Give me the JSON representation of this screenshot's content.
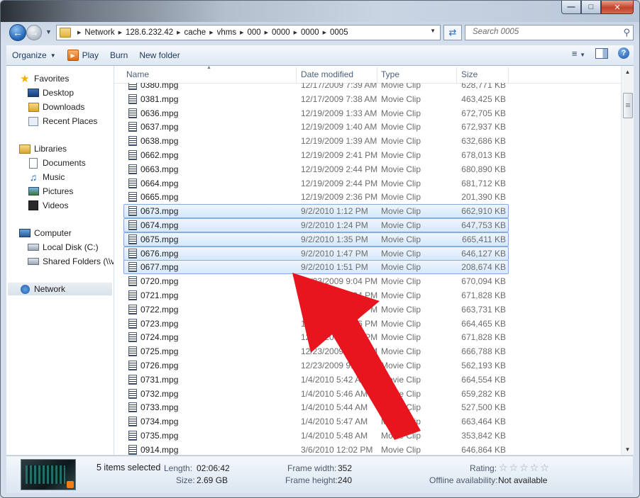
{
  "window": {
    "caption": {
      "minimize": "—",
      "maximize": "□",
      "close": "✕"
    }
  },
  "address": {
    "crumbs": [
      "Network",
      "128.6.232.42",
      "cache",
      "vhms",
      "000",
      "0000",
      "0000",
      "0005"
    ],
    "search_placeholder": "Search 0005"
  },
  "toolbar": {
    "organize": "Organize",
    "play": "Play",
    "burn": "Burn",
    "new_folder": "New folder"
  },
  "sidebar": {
    "favorites": "Favorites",
    "desktop": "Desktop",
    "downloads": "Downloads",
    "recent": "Recent Places",
    "libraries": "Libraries",
    "documents": "Documents",
    "music": "Music",
    "pictures": "Pictures",
    "videos": "Videos",
    "computer": "Computer",
    "local_disk": "Local Disk (C:)",
    "shared": "Shared Folders (\\\\vm",
    "network": "Network"
  },
  "columns": {
    "name": "Name",
    "date": "Date modified",
    "type": "Type",
    "size": "Size"
  },
  "files": [
    {
      "name": "0380.mpg",
      "date": "12/17/2009 7:39 AM",
      "type": "Movie Clip",
      "size": "628,771 KB",
      "selected": false
    },
    {
      "name": "0381.mpg",
      "date": "12/17/2009 7:38 AM",
      "type": "Movie Clip",
      "size": "463,425 KB",
      "selected": false
    },
    {
      "name": "0636.mpg",
      "date": "12/19/2009 1:33 AM",
      "type": "Movie Clip",
      "size": "672,705 KB",
      "selected": false
    },
    {
      "name": "0637.mpg",
      "date": "12/19/2009 1:40 AM",
      "type": "Movie Clip",
      "size": "672,937 KB",
      "selected": false
    },
    {
      "name": "0638.mpg",
      "date": "12/19/2009 1:39 AM",
      "type": "Movie Clip",
      "size": "632,686 KB",
      "selected": false
    },
    {
      "name": "0662.mpg",
      "date": "12/19/2009 2:41 PM",
      "type": "Movie Clip",
      "size": "678,013 KB",
      "selected": false
    },
    {
      "name": "0663.mpg",
      "date": "12/19/2009 2:44 PM",
      "type": "Movie Clip",
      "size": "680,890 KB",
      "selected": false
    },
    {
      "name": "0664.mpg",
      "date": "12/19/2009 2:44 PM",
      "type": "Movie Clip",
      "size": "681,712 KB",
      "selected": false
    },
    {
      "name": "0665.mpg",
      "date": "12/19/2009 2:36 PM",
      "type": "Movie Clip",
      "size": "201,390 KB",
      "selected": false
    },
    {
      "name": "0673.mpg",
      "date": "9/2/2010 1:12 PM",
      "type": "Movie Clip",
      "size": "662,910 KB",
      "selected": true
    },
    {
      "name": "0674.mpg",
      "date": "9/2/2010 1:24 PM",
      "type": "Movie Clip",
      "size": "647,753 KB",
      "selected": true
    },
    {
      "name": "0675.mpg",
      "date": "9/2/2010 1:35 PM",
      "type": "Movie Clip",
      "size": "665,411 KB",
      "selected": true
    },
    {
      "name": "0676.mpg",
      "date": "9/2/2010 1:47 PM",
      "type": "Movie Clip",
      "size": "646,127 KB",
      "selected": true
    },
    {
      "name": "0677.mpg",
      "date": "9/2/2010 1:51 PM",
      "type": "Movie Clip",
      "size": "208,674 KB",
      "selected": true
    },
    {
      "name": "0720.mpg",
      "date": "12/23/2009 9:04 PM",
      "type": "Movie Clip",
      "size": "670,094 KB",
      "selected": false
    },
    {
      "name": "0721.mpg",
      "date": "12/23/2009 9:04 PM",
      "type": "Movie Clip",
      "size": "671,828 KB",
      "selected": false
    },
    {
      "name": "0722.mpg",
      "date": "12/23/2009 9:04 PM",
      "type": "Movie Clip",
      "size": "663,731 KB",
      "selected": false
    },
    {
      "name": "0723.mpg",
      "date": "12/23/2009 9:06 PM",
      "type": "Movie Clip",
      "size": "664,465 KB",
      "selected": false
    },
    {
      "name": "0724.mpg",
      "date": "12/23/2009 9:09 PM",
      "type": "Movie Clip",
      "size": "671,828 KB",
      "selected": false
    },
    {
      "name": "0725.mpg",
      "date": "12/23/2009 9:10 PM",
      "type": "Movie Clip",
      "size": "666,788 KB",
      "selected": false
    },
    {
      "name": "0726.mpg",
      "date": "12/23/2009 9:14 PM",
      "type": "Movie Clip",
      "size": "562,193 KB",
      "selected": false
    },
    {
      "name": "0731.mpg",
      "date": "1/4/2010 5:42 AM",
      "type": "Movie Clip",
      "size": "664,554 KB",
      "selected": false
    },
    {
      "name": "0732.mpg",
      "date": "1/4/2010 5:46 AM",
      "type": "Movie Clip",
      "size": "659,282 KB",
      "selected": false
    },
    {
      "name": "0733.mpg",
      "date": "1/4/2010 5:44 AM",
      "type": "Movie Clip",
      "size": "527,500 KB",
      "selected": false
    },
    {
      "name": "0734.mpg",
      "date": "1/4/2010 5:47 AM",
      "type": "Movie Clip",
      "size": "663,464 KB",
      "selected": false
    },
    {
      "name": "0735.mpg",
      "date": "1/4/2010 5:48 AM",
      "type": "Movie Clip",
      "size": "353,842 KB",
      "selected": false
    },
    {
      "name": "0914.mpg",
      "date": "3/6/2010 12:02 PM",
      "type": "Movie Clip",
      "size": "646,864 KB",
      "selected": false
    }
  ],
  "details": {
    "count": "5 items selected",
    "length_label": "Length:",
    "length_value": "02:06:42",
    "size_label": "Size:",
    "size_value": "2.69 GB",
    "fw_label": "Frame width:",
    "fw_value": "352",
    "fh_label": "Frame height:",
    "fh_value": "240",
    "rating_label": "Rating:",
    "rating_stars": "☆☆☆☆☆",
    "offline_label": "Offline availability:",
    "offline_value": "Not available"
  },
  "colors": {
    "selection_fill": "#d6e8fb",
    "selection_border": "#84acdd",
    "annotation_arrow": "#e8141e"
  }
}
